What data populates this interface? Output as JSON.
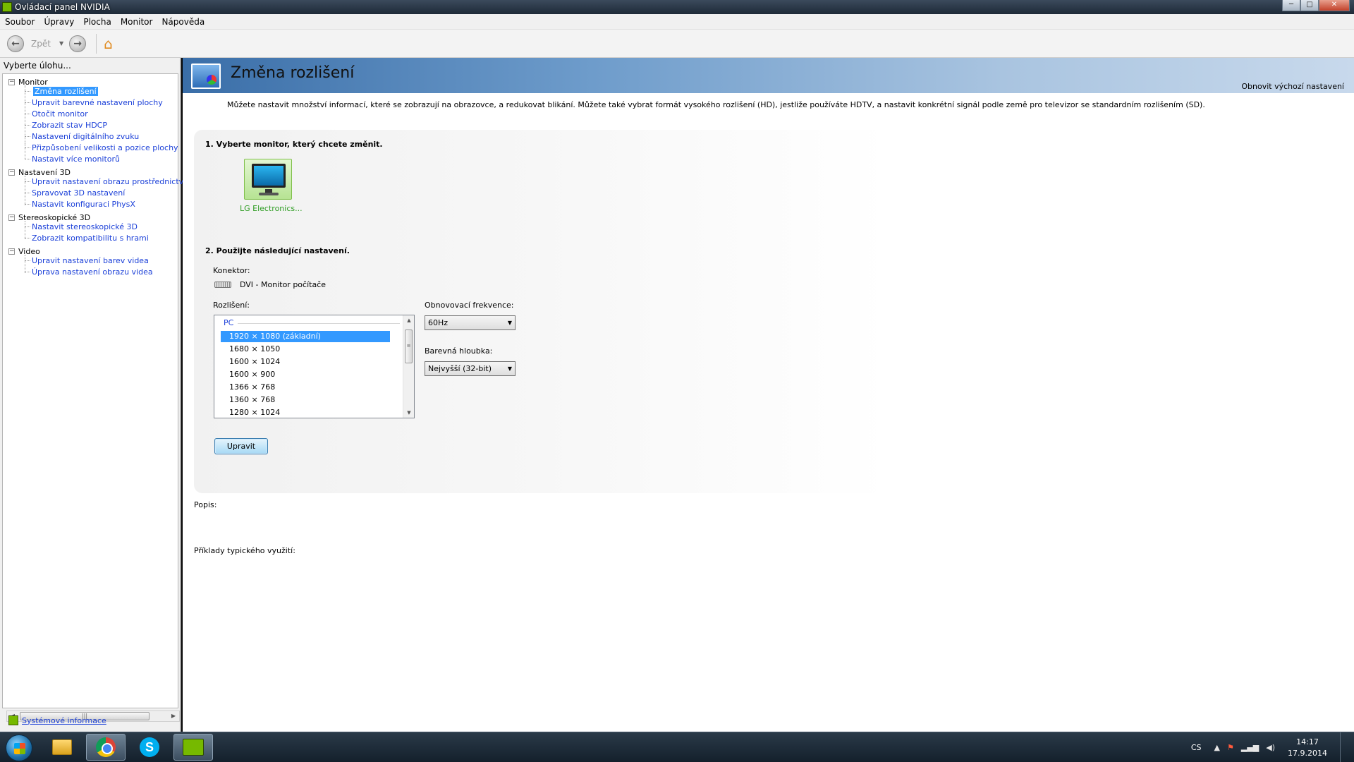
{
  "window": {
    "title": "Ovládací panel NVIDIA",
    "controls": {
      "minimize": "─",
      "maximize": "□",
      "close": "✕"
    }
  },
  "menu": {
    "items": [
      "Soubor",
      "Úpravy",
      "Plocha",
      "Monitor",
      "Nápověda"
    ]
  },
  "toolbar": {
    "back_label": "Zpět",
    "back_icon": "arrow-left-icon",
    "forward_icon": "arrow-right-icon",
    "home_icon": "home-icon"
  },
  "sidebar": {
    "prompt": "Vyberte úlohu...",
    "categories": [
      {
        "label": "Monitor",
        "items": [
          "Změna rozlišení",
          "Upravit barevné nastavení plochy",
          "Otočit monitor",
          "Zobrazit stav HDCP",
          "Nastavení digitálního zvuku",
          "Přizpůsobení velikosti a pozice plochy",
          "Nastavit více monitorů"
        ]
      },
      {
        "label": "Nastavení 3D",
        "items": [
          "Upravit nastavení obrazu prostřednictvím n",
          "Spravovat 3D nastavení",
          "Nastavit konfiguraci PhysX"
        ]
      },
      {
        "label": "Stereoskopické 3D",
        "items": [
          "Nastavit stereoskopické 3D",
          "Zobrazit kompatibilitu s hrami"
        ]
      },
      {
        "label": "Video",
        "items": [
          "Upravit nastavení barev videa",
          "Úprava nastavení obrazu videa"
        ]
      }
    ],
    "selected": "Změna rozlišení",
    "system_info": "Systémové informace"
  },
  "main": {
    "title": "Změna rozlišení",
    "restore_defaults": "Obnovit výchozí nastavení",
    "intro": "Můžete nastavit množství informací, které se zobrazují na obrazovce, a redukovat blikání. Můžete také vybrat formát vysokého rozlišení (HD), jestliže používáte HDTV, a nastavit konkrétní signál podle země pro televizor se standardním rozlišením (SD).",
    "step1": "1. Vyberte monitor, který chcete změnit.",
    "monitor_name": "LG Electronics...",
    "step2": "2. Použijte následující nastavení.",
    "connector_label": "Konektor:",
    "connector_value": "DVI - Monitor počítače",
    "resolution_label": "Rozlišení:",
    "resolution_group": "PC",
    "resolutions": [
      "1920 × 1080 (základní)",
      "1680 × 1050",
      "1600 × 1024",
      "1600 × 900",
      "1366 × 768",
      "1360 × 768",
      "1280 × 1024"
    ],
    "selected_resolution": "1920 × 1080 (základní)",
    "refresh_label": "Obnovovací frekvence:",
    "refresh_value": "60Hz",
    "depth_label": "Barevná hloubka:",
    "depth_value": "Nejvyšší (32-bit)",
    "apply_button": "Upravit",
    "description_label": "Popis:",
    "examples_label": "Příklady typického využití:"
  },
  "taskbar": {
    "apps": [
      "windows-explorer",
      "chrome",
      "skype",
      "nvidia-control-panel"
    ],
    "language": "CS",
    "time": "14:17",
    "date": "17.9.2014"
  }
}
